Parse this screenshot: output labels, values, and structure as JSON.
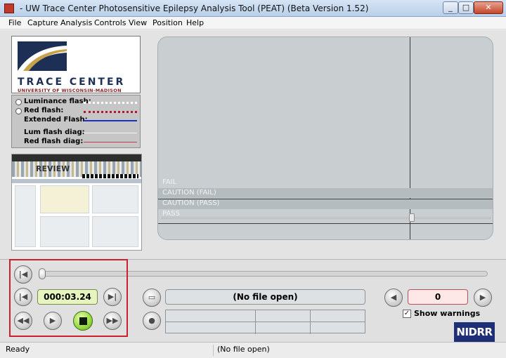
{
  "window": {
    "title": "- UW Trace Center Photosensitive Epilepsy Analysis Tool (PEAT) (Beta Version 1.52)",
    "min_label": "_",
    "max_label": "□",
    "close_label": "✕"
  },
  "menu": [
    {
      "label": "File"
    },
    {
      "label": "Capture"
    },
    {
      "label": "Analysis"
    },
    {
      "label": "Controls"
    },
    {
      "label": "View"
    },
    {
      "label": "Position"
    },
    {
      "label": "Help"
    }
  ],
  "logo": {
    "name": "TRACE CENTER",
    "subtitle": "UNIVERSITY OF WISCONSIN-MADISON",
    "colors": {
      "navy": "#1d2f55",
      "gold": "#c8a24a",
      "red": "#8a1c1c"
    }
  },
  "legend": [
    {
      "label": "Luminance flash:",
      "radio": true,
      "line_color": "#ffffff",
      "style": "dotted"
    },
    {
      "label": "Red flash:",
      "radio": true,
      "line_color": "#b0182c",
      "style": "dotted"
    },
    {
      "label": "Extended Flash:",
      "radio": false,
      "line_color": "#1830c8",
      "style": "solid"
    },
    {
      "label": "Lum flash diag:",
      "radio": false,
      "line_color": "#f4f4f4",
      "style": "solid"
    },
    {
      "label": "Red flash diag:",
      "radio": false,
      "line_color": "#c04050",
      "style": "solid"
    }
  ],
  "thumbnail": {
    "banner_text": "REVIEW"
  },
  "graph": {
    "zones": [
      {
        "label": "FAIL"
      },
      {
        "label": "CAUTION (FAIL)"
      },
      {
        "label": "CAUTION (PASS)"
      },
      {
        "label": "PASS"
      }
    ],
    "background": "#c9cfd1"
  },
  "controls": {
    "rewind_start_icon": "rewind-to-start-icon",
    "skip_back_icon": "skip-back-icon",
    "skip_forward_icon": "skip-forward-icon",
    "fast_rewind_icon": "fast-rewind-icon",
    "play_icon": "play-icon",
    "stop_icon": "stop-icon",
    "fast_forward_icon": "fast-forward-icon",
    "time": "000:03.24",
    "progress": 0
  },
  "file": {
    "display": "(No file open)",
    "open_icon": "folder-open-icon",
    "record_icon": "record-icon"
  },
  "warnings": {
    "count": "0",
    "show_warnings_label": "Show warnings",
    "show_warnings_checked": true,
    "check_mark": "✓",
    "prev_icon": "warning-prev-icon",
    "next_icon": "warning-next-icon"
  },
  "badge": {
    "text": "NIDRR"
  },
  "status": {
    "left": "Ready",
    "middle": "(No file open)"
  }
}
